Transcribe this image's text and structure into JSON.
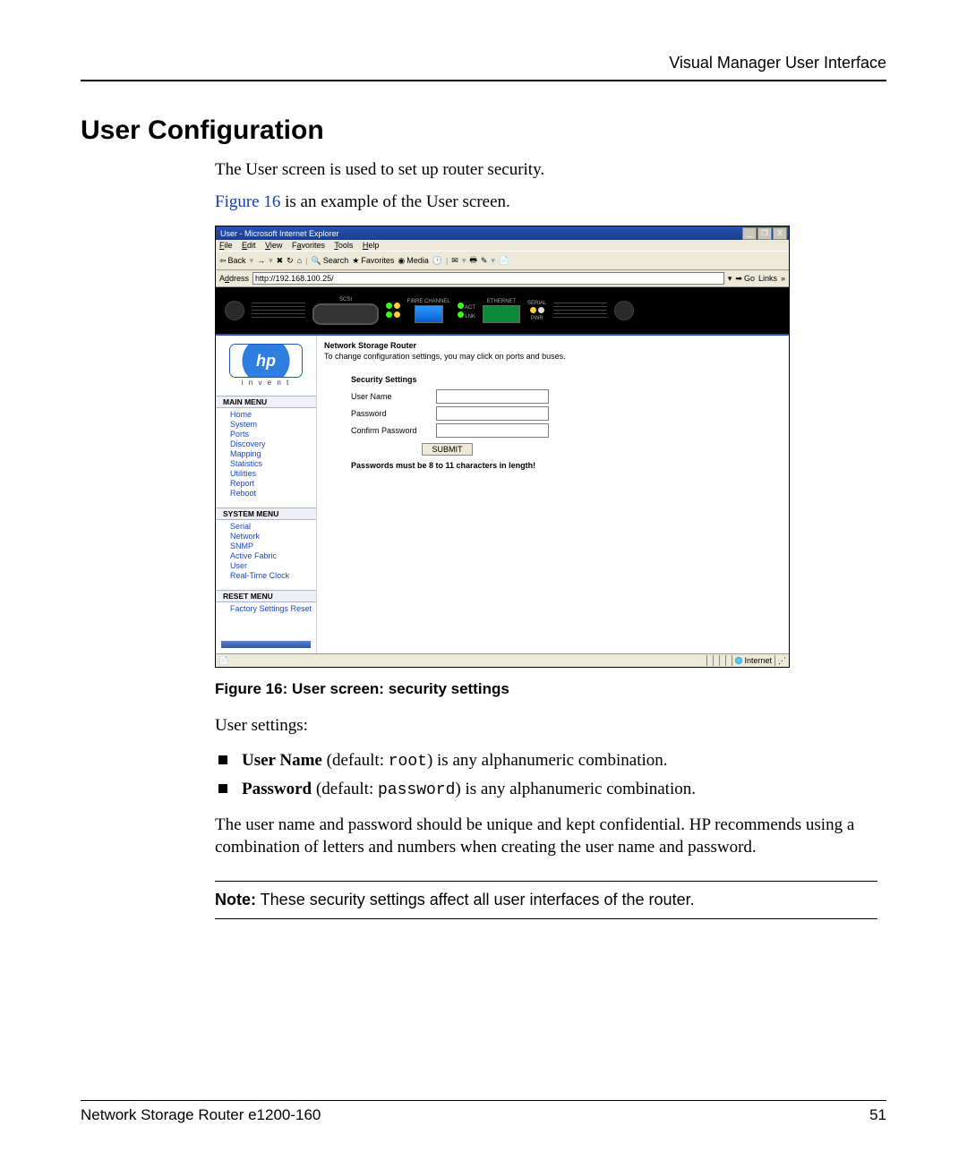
{
  "header": {
    "title": "Visual Manager User Interface"
  },
  "section": {
    "title": "User Configuration"
  },
  "intro": {
    "line1": "The User screen is used to set up router security.",
    "figref": "Figure 16",
    "line2_rest": " is an example of the User screen."
  },
  "screenshot": {
    "window_title": "User - Microsoft Internet Explorer",
    "win_ctrl": {
      "min": "_",
      "max": "❐",
      "close": "X"
    },
    "menu": {
      "file": "File",
      "edit": "Edit",
      "view": "View",
      "favorites": "Favorites",
      "tools": "Tools",
      "help": "Help"
    },
    "toolbar": {
      "back": "Back",
      "forward": "",
      "stop": "",
      "refresh": "",
      "home": "",
      "search": "Search",
      "favorites": "Favorites",
      "media": "Media",
      "history": "",
      "mail": "",
      "print": "",
      "edit": "",
      "messenger": ""
    },
    "addr": {
      "label": "Address",
      "value": "http://192.168.100.25/",
      "go": "Go",
      "links": "Links"
    },
    "banner": {
      "scsi": "SCSI",
      "fibre": "FIBRE CHANNEL",
      "act": "ACT",
      "lnk": "LNK",
      "ethernet": "ETHERNET",
      "serial": "SERIAL",
      "pwr": "PWR"
    },
    "header_area": {
      "title": "Network Storage Router",
      "subtitle": "To change configuration settings, you may click on ports and buses."
    },
    "logo": {
      "text": "hp",
      "tag": "i n v e n t"
    },
    "menus": {
      "main_label": "MAIN MENU",
      "main": [
        "Home",
        "System",
        "Ports",
        "Discovery",
        "Mapping",
        "Statistics",
        "Utilities",
        "Report",
        "Reboot"
      ],
      "system_label": "SYSTEM MENU",
      "system": [
        "Serial",
        "Network",
        "SNMP",
        "Active Fabric",
        "User",
        "Real-Time Clock"
      ],
      "reset_label": "RESET MENU",
      "reset": [
        "Factory Settings Reset"
      ]
    },
    "form": {
      "section": "Security Settings",
      "user_label": "User Name",
      "pw_label": "Password",
      "cpw_label": "Confirm Password",
      "submit": "SUBMIT",
      "hint": "Passwords must be 8 to 11 characters in length!"
    },
    "status": {
      "zone": "Internet"
    }
  },
  "caption": "Figure 16:  User screen: security settings",
  "body": {
    "user_settings": "User settings:",
    "b1a": "User Name",
    "b1b": " (default: ",
    "b1c": "root",
    "b1d": ") is any alphanumeric combination.",
    "b2a": "Password",
    "b2b": " (default: ",
    "b2c": "password",
    "b2d": ") is any alphanumeric combination.",
    "para": "The user name and password should be unique and kept confidential. HP recommends using a combination of letters and numbers when creating the user name and password."
  },
  "note": {
    "label": "Note:",
    "text": "  These security settings affect all user interfaces of the router."
  },
  "footer": {
    "left": "Network Storage Router e1200-160",
    "right": "51"
  }
}
